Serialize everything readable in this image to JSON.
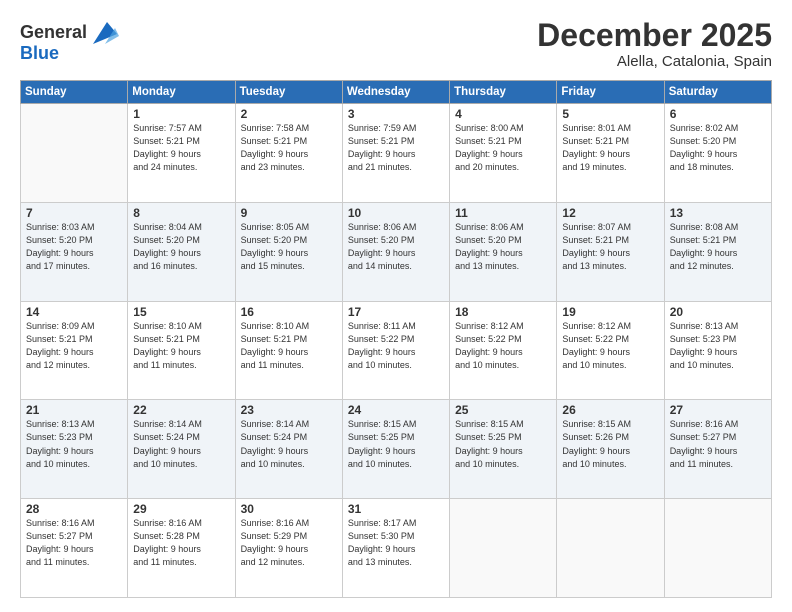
{
  "logo": {
    "line1": "General",
    "line2": "Blue"
  },
  "title": "December 2025",
  "subtitle": "Alella, Catalonia, Spain",
  "days_of_week": [
    "Sunday",
    "Monday",
    "Tuesday",
    "Wednesday",
    "Thursday",
    "Friday",
    "Saturday"
  ],
  "weeks": [
    [
      {
        "day": "",
        "info": ""
      },
      {
        "day": "1",
        "info": "Sunrise: 7:57 AM\nSunset: 5:21 PM\nDaylight: 9 hours\nand 24 minutes."
      },
      {
        "day": "2",
        "info": "Sunrise: 7:58 AM\nSunset: 5:21 PM\nDaylight: 9 hours\nand 23 minutes."
      },
      {
        "day": "3",
        "info": "Sunrise: 7:59 AM\nSunset: 5:21 PM\nDaylight: 9 hours\nand 21 minutes."
      },
      {
        "day": "4",
        "info": "Sunrise: 8:00 AM\nSunset: 5:21 PM\nDaylight: 9 hours\nand 20 minutes."
      },
      {
        "day": "5",
        "info": "Sunrise: 8:01 AM\nSunset: 5:21 PM\nDaylight: 9 hours\nand 19 minutes."
      },
      {
        "day": "6",
        "info": "Sunrise: 8:02 AM\nSunset: 5:20 PM\nDaylight: 9 hours\nand 18 minutes."
      }
    ],
    [
      {
        "day": "7",
        "info": "Sunrise: 8:03 AM\nSunset: 5:20 PM\nDaylight: 9 hours\nand 17 minutes."
      },
      {
        "day": "8",
        "info": "Sunrise: 8:04 AM\nSunset: 5:20 PM\nDaylight: 9 hours\nand 16 minutes."
      },
      {
        "day": "9",
        "info": "Sunrise: 8:05 AM\nSunset: 5:20 PM\nDaylight: 9 hours\nand 15 minutes."
      },
      {
        "day": "10",
        "info": "Sunrise: 8:06 AM\nSunset: 5:20 PM\nDaylight: 9 hours\nand 14 minutes."
      },
      {
        "day": "11",
        "info": "Sunrise: 8:06 AM\nSunset: 5:20 PM\nDaylight: 9 hours\nand 13 minutes."
      },
      {
        "day": "12",
        "info": "Sunrise: 8:07 AM\nSunset: 5:21 PM\nDaylight: 9 hours\nand 13 minutes."
      },
      {
        "day": "13",
        "info": "Sunrise: 8:08 AM\nSunset: 5:21 PM\nDaylight: 9 hours\nand 12 minutes."
      }
    ],
    [
      {
        "day": "14",
        "info": "Sunrise: 8:09 AM\nSunset: 5:21 PM\nDaylight: 9 hours\nand 12 minutes."
      },
      {
        "day": "15",
        "info": "Sunrise: 8:10 AM\nSunset: 5:21 PM\nDaylight: 9 hours\nand 11 minutes."
      },
      {
        "day": "16",
        "info": "Sunrise: 8:10 AM\nSunset: 5:21 PM\nDaylight: 9 hours\nand 11 minutes."
      },
      {
        "day": "17",
        "info": "Sunrise: 8:11 AM\nSunset: 5:22 PM\nDaylight: 9 hours\nand 10 minutes."
      },
      {
        "day": "18",
        "info": "Sunrise: 8:12 AM\nSunset: 5:22 PM\nDaylight: 9 hours\nand 10 minutes."
      },
      {
        "day": "19",
        "info": "Sunrise: 8:12 AM\nSunset: 5:22 PM\nDaylight: 9 hours\nand 10 minutes."
      },
      {
        "day": "20",
        "info": "Sunrise: 8:13 AM\nSunset: 5:23 PM\nDaylight: 9 hours\nand 10 minutes."
      }
    ],
    [
      {
        "day": "21",
        "info": "Sunrise: 8:13 AM\nSunset: 5:23 PM\nDaylight: 9 hours\nand 10 minutes."
      },
      {
        "day": "22",
        "info": "Sunrise: 8:14 AM\nSunset: 5:24 PM\nDaylight: 9 hours\nand 10 minutes."
      },
      {
        "day": "23",
        "info": "Sunrise: 8:14 AM\nSunset: 5:24 PM\nDaylight: 9 hours\nand 10 minutes."
      },
      {
        "day": "24",
        "info": "Sunrise: 8:15 AM\nSunset: 5:25 PM\nDaylight: 9 hours\nand 10 minutes."
      },
      {
        "day": "25",
        "info": "Sunrise: 8:15 AM\nSunset: 5:25 PM\nDaylight: 9 hours\nand 10 minutes."
      },
      {
        "day": "26",
        "info": "Sunrise: 8:15 AM\nSunset: 5:26 PM\nDaylight: 9 hours\nand 10 minutes."
      },
      {
        "day": "27",
        "info": "Sunrise: 8:16 AM\nSunset: 5:27 PM\nDaylight: 9 hours\nand 11 minutes."
      }
    ],
    [
      {
        "day": "28",
        "info": "Sunrise: 8:16 AM\nSunset: 5:27 PM\nDaylight: 9 hours\nand 11 minutes."
      },
      {
        "day": "29",
        "info": "Sunrise: 8:16 AM\nSunset: 5:28 PM\nDaylight: 9 hours\nand 11 minutes."
      },
      {
        "day": "30",
        "info": "Sunrise: 8:16 AM\nSunset: 5:29 PM\nDaylight: 9 hours\nand 12 minutes."
      },
      {
        "day": "31",
        "info": "Sunrise: 8:17 AM\nSunset: 5:30 PM\nDaylight: 9 hours\nand 13 minutes."
      },
      {
        "day": "",
        "info": ""
      },
      {
        "day": "",
        "info": ""
      },
      {
        "day": "",
        "info": ""
      }
    ]
  ]
}
